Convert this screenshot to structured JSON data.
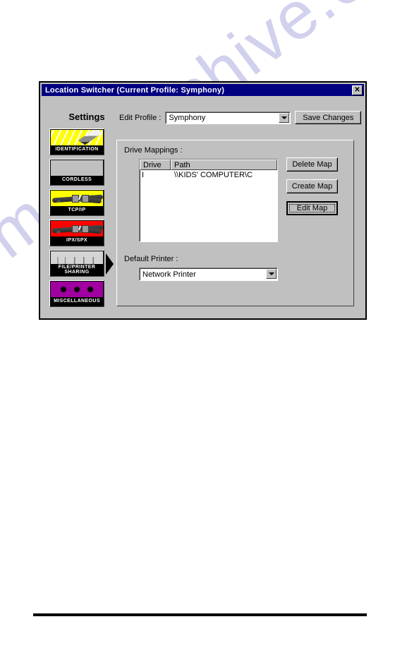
{
  "window": {
    "title": "Location Switcher (Current Profile: Symphony)",
    "close_label": "✕",
    "titlebar_color": "#000080",
    "face_color": "#c0c0c0"
  },
  "toolbar": {
    "edit_profile_label": "Edit Profile :",
    "profile_value": "Symphony",
    "profile_placeholder": "Symphony",
    "save_label": "Save Changes"
  },
  "sidebar": {
    "heading": "Settings",
    "items": [
      {
        "label": "IDENTIFICATION",
        "art": "pencil-on-yellow",
        "selected": false
      },
      {
        "label": "CORDLESS",
        "art": "blank-gray",
        "selected": false
      },
      {
        "label": "TCP/IP",
        "art": "yellow-cable",
        "selected": false
      },
      {
        "label": "IPX/SPX",
        "art": "red-cable",
        "selected": false
      },
      {
        "label": "FILE/PRINTER\nSHARING",
        "art": "gray-wires",
        "selected": true
      },
      {
        "label": "MISCELLANEOUS",
        "art": "purple-dots",
        "selected": false
      }
    ]
  },
  "main": {
    "drive_mappings_label": "Drive Mappings :",
    "list": {
      "columns": [
        "Drive",
        "Path"
      ],
      "rows": [
        {
          "drive": "I",
          "path": "\\\\KIDS' COMPUTER\\C"
        }
      ]
    },
    "buttons": {
      "delete_map": "Delete Map",
      "create_map": "Create Map",
      "edit_map": "Edit Map"
    },
    "default_printer_label": "Default Printer :",
    "printer_value": "Network Printer",
    "printer_placeholder": "Network Printer"
  },
  "watermark": {
    "text": "manualshive.com",
    "color": "#c9c9ec"
  }
}
